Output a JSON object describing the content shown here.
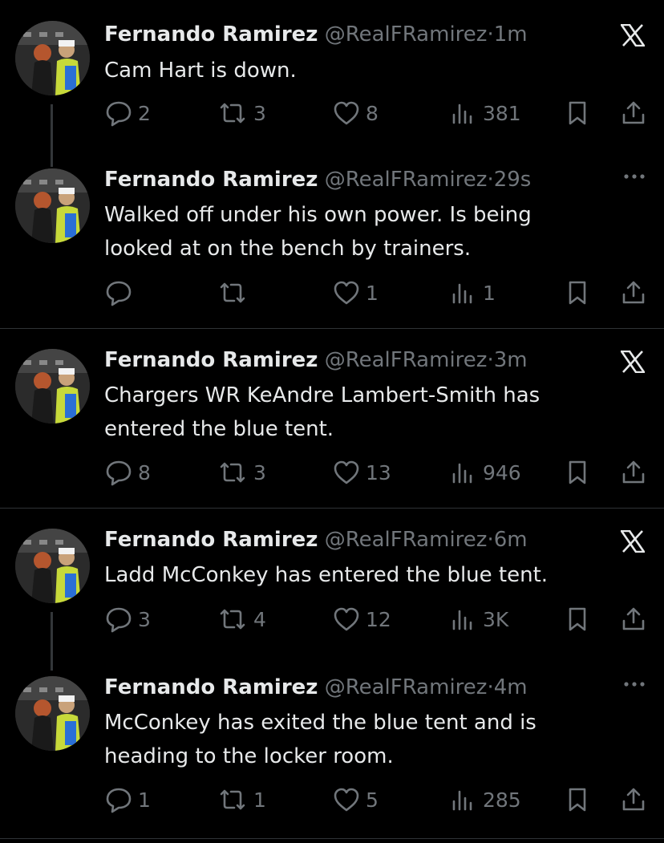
{
  "groups": [
    {
      "tweets": [
        {
          "name": "Fernando Ramirez",
          "handle": "@RealFRamirez",
          "dot": "·",
          "time": "1m",
          "text": "Cam Hart is down.",
          "corner": "x-logo",
          "replies": "2",
          "reposts": "3",
          "likes": "8",
          "views": "381"
        },
        {
          "name": "Fernando Ramirez",
          "handle": "@RealFRamirez",
          "dot": "·",
          "time": "29s",
          "text": "Walked off under his own power. Is being looked at on the bench by trainers.",
          "corner": "more",
          "replies": "",
          "reposts": "",
          "likes": "1",
          "views": "1"
        }
      ]
    },
    {
      "tweets": [
        {
          "name": "Fernando Ramirez",
          "handle": "@RealFRamirez",
          "dot": "·",
          "time": "3m",
          "text": "Chargers WR KeAndre Lambert-Smith has entered the blue tent.",
          "corner": "x-logo",
          "replies": "8",
          "reposts": "3",
          "likes": "13",
          "views": "946"
        }
      ]
    },
    {
      "tweets": [
        {
          "name": "Fernando Ramirez",
          "handle": "@RealFRamirez",
          "dot": "·",
          "time": "6m",
          "text": "Ladd McConkey has entered the blue tent.",
          "corner": "x-logo",
          "replies": "3",
          "reposts": "4",
          "likes": "12",
          "views": "3K"
        },
        {
          "name": "Fernando Ramirez",
          "handle": "@RealFRamirez",
          "dot": "·",
          "time": "4m",
          "text": "McConkey has exited the blue tent and is heading to the locker room.",
          "corner": "more",
          "replies": "1",
          "reposts": "1",
          "likes": "5",
          "views": "285"
        }
      ]
    }
  ],
  "colors": {
    "background": "#000000",
    "text": "#e7e9ea",
    "muted": "#71767b",
    "divider": "#2f3336"
  },
  "icons": [
    "reply-icon",
    "repost-icon",
    "like-icon",
    "views-icon",
    "bookmark-icon",
    "share-icon",
    "x-logo-icon",
    "more-icon"
  ]
}
